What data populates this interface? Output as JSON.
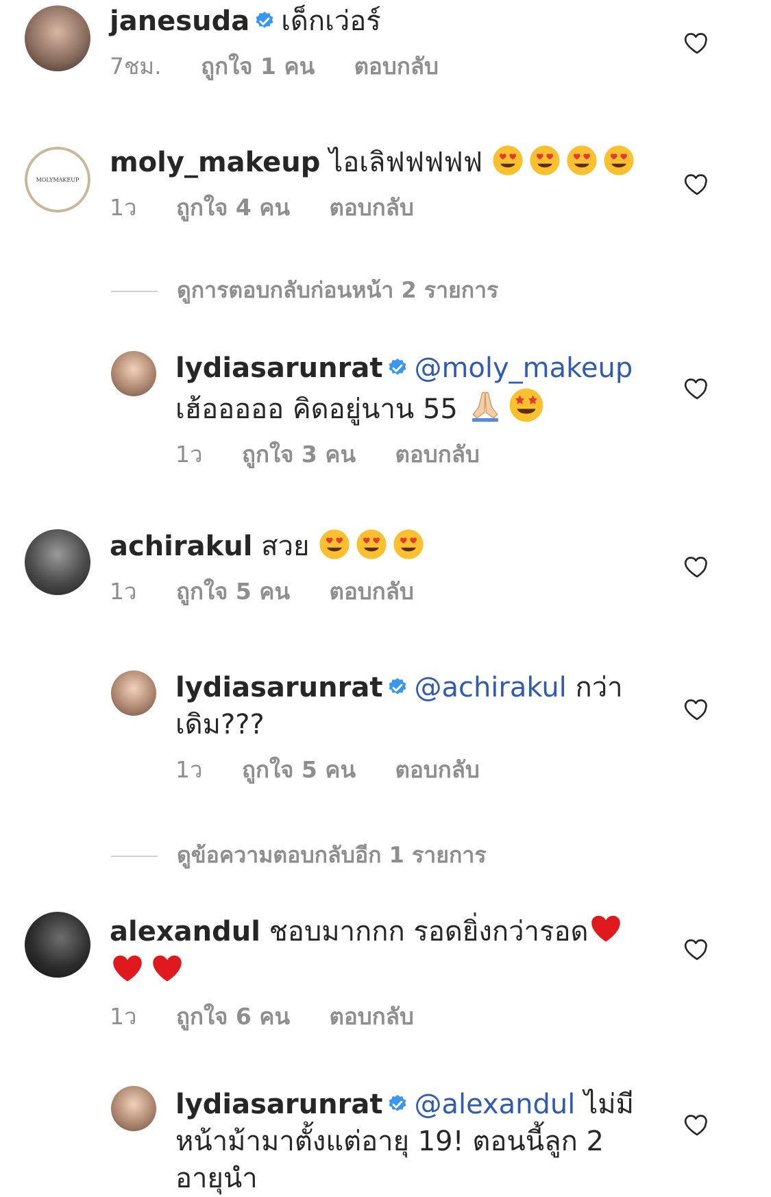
{
  "comments": [
    {
      "username": "janesuda",
      "verified": true,
      "text": "เด็กเว่อร์",
      "time": "7ชม.",
      "likes": "ถูกใจ 1 คน",
      "reply": "ตอบกลับ"
    },
    {
      "username": "moly_makeup",
      "verified": false,
      "text": "ไอเลิฟฟฟฟฟ",
      "emojis": [
        "heart-eyes",
        "heart-eyes",
        "heart-eyes",
        "heart-eyes"
      ],
      "time": "1ว",
      "likes": "ถูกใจ 4 คน",
      "reply": "ตอบกลับ",
      "avatar_text": "MOLYMAKEUP"
    },
    {
      "username": "achirakul",
      "verified": false,
      "text": "สวย",
      "emojis": [
        "heart-eyes",
        "heart-eyes",
        "heart-eyes"
      ],
      "time": "1ว",
      "likes": "ถูกใจ 5 คน",
      "reply": "ตอบกลับ"
    },
    {
      "username": "alexandul",
      "verified": false,
      "text": "ชอบมากกก รอดยิ่งกว่ารอด",
      "emojis": [
        "red-heart",
        "red-heart",
        "red-heart"
      ],
      "time": "1ว",
      "likes": "ถูกใจ 6 คน",
      "reply": "ตอบกลับ"
    }
  ],
  "replies": [
    {
      "username": "lydiasarunrat",
      "verified": true,
      "mention": "@moly_makeup",
      "text": "เฮ้อออออ คิดอยู่นาน 55",
      "emojis": [
        "folded-hands",
        "star-struck"
      ],
      "time": "1ว",
      "likes": "ถูกใจ 3 คน",
      "reply": "ตอบกลับ"
    },
    {
      "username": "lydiasarunrat",
      "verified": true,
      "mention": "@achirakul",
      "text": "กว่าเดิม???",
      "time": "1ว",
      "likes": "ถูกใจ 5 คน",
      "reply": "ตอบกลับ"
    },
    {
      "username": "lydiasarunrat",
      "verified": true,
      "mention": "@alexandul",
      "text": "ไม่มีหน้าม้ามาตั้งแต่อายุ 19! ตอนนี้ลูก 2 อายุนำ",
      "time": "",
      "likes": "",
      "reply": ""
    }
  ],
  "view_more": [
    "ดูการตอบกลับก่อนหน้า 2 รายการ",
    "ดูข้อความตอบกลับอีก 1 รายการ"
  ],
  "colors": {
    "text": "#262626",
    "muted": "#8e8e8e",
    "mention": "#2f5bb0",
    "verified": "#3897f0"
  },
  "icons": {
    "like": "heart-outline-icon",
    "verified": "verified-badge-icon"
  }
}
